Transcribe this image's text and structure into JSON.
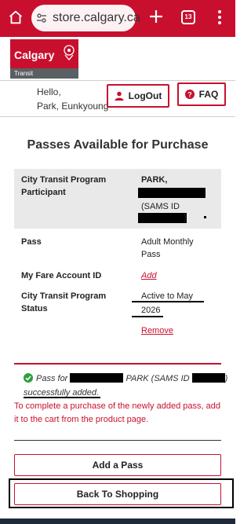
{
  "browser": {
    "url": "store.calgary.ca",
    "tab_count": "13"
  },
  "logo": {
    "wordmark": "Calgary",
    "sub": "Transit"
  },
  "user": {
    "greeting_line1": "Hello,",
    "greeting_line2": "Park, Eunkyoung"
  },
  "header_buttons": {
    "logout": "LogOut",
    "faq": "FAQ"
  },
  "page_title": "Passes Available for Purchase",
  "details": {
    "participant_label": "City Transit Program Participant",
    "participant_name": "PARK,",
    "participant_sams": "(SAMS ID",
    "participant_close": ")",
    "pass_label": "Pass",
    "pass_value": "Adult Monthly Pass",
    "fare_account_label": "My Fare Account ID",
    "fare_account_action": "Add",
    "status_label": "City Transit Program Status",
    "status_value_line1": "Active to May",
    "status_value_line2": "2026",
    "status_action": "Remove"
  },
  "success": {
    "prefix": "Pass for",
    "middle": "PARK (SAMS ID",
    "suffix": ")",
    "line2": "successfully added."
  },
  "notice": "To complete a purchase of the newly added pass, add it to the cart from the product page.",
  "actions": {
    "add_pass": "Add a Pass",
    "back_to_shopping": "Back To Shopping"
  },
  "colors": {
    "brand_red": "#c8102e",
    "success_green": "#2e9e3e"
  }
}
